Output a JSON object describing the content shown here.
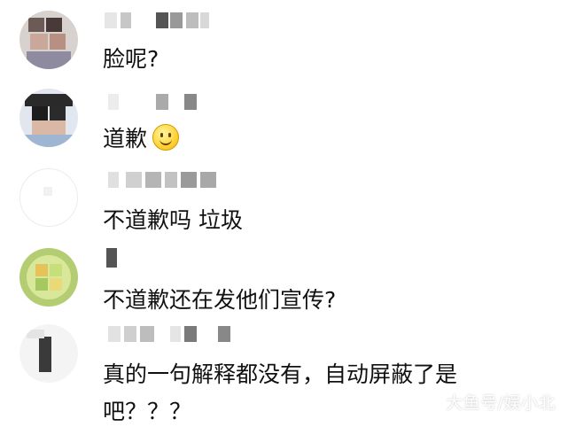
{
  "comments": [
    {
      "text": "脸呢?",
      "emoji": ""
    },
    {
      "text": "道歉",
      "emoji": "smile-emoji-icon"
    },
    {
      "text": "不道歉吗 垃圾",
      "emoji": ""
    },
    {
      "text": "不道歉还在发他们宣传?",
      "emoji": ""
    },
    {
      "text_line1": "真的一句解释都没有，自动屏蔽了是",
      "text_line2": "吧？？？",
      "emoji": ""
    }
  ],
  "watermark": "大鱼号/娱小北",
  "colors": {
    "text": "#111111",
    "background": "#ffffff",
    "mosaic": "#9a9a9a"
  }
}
